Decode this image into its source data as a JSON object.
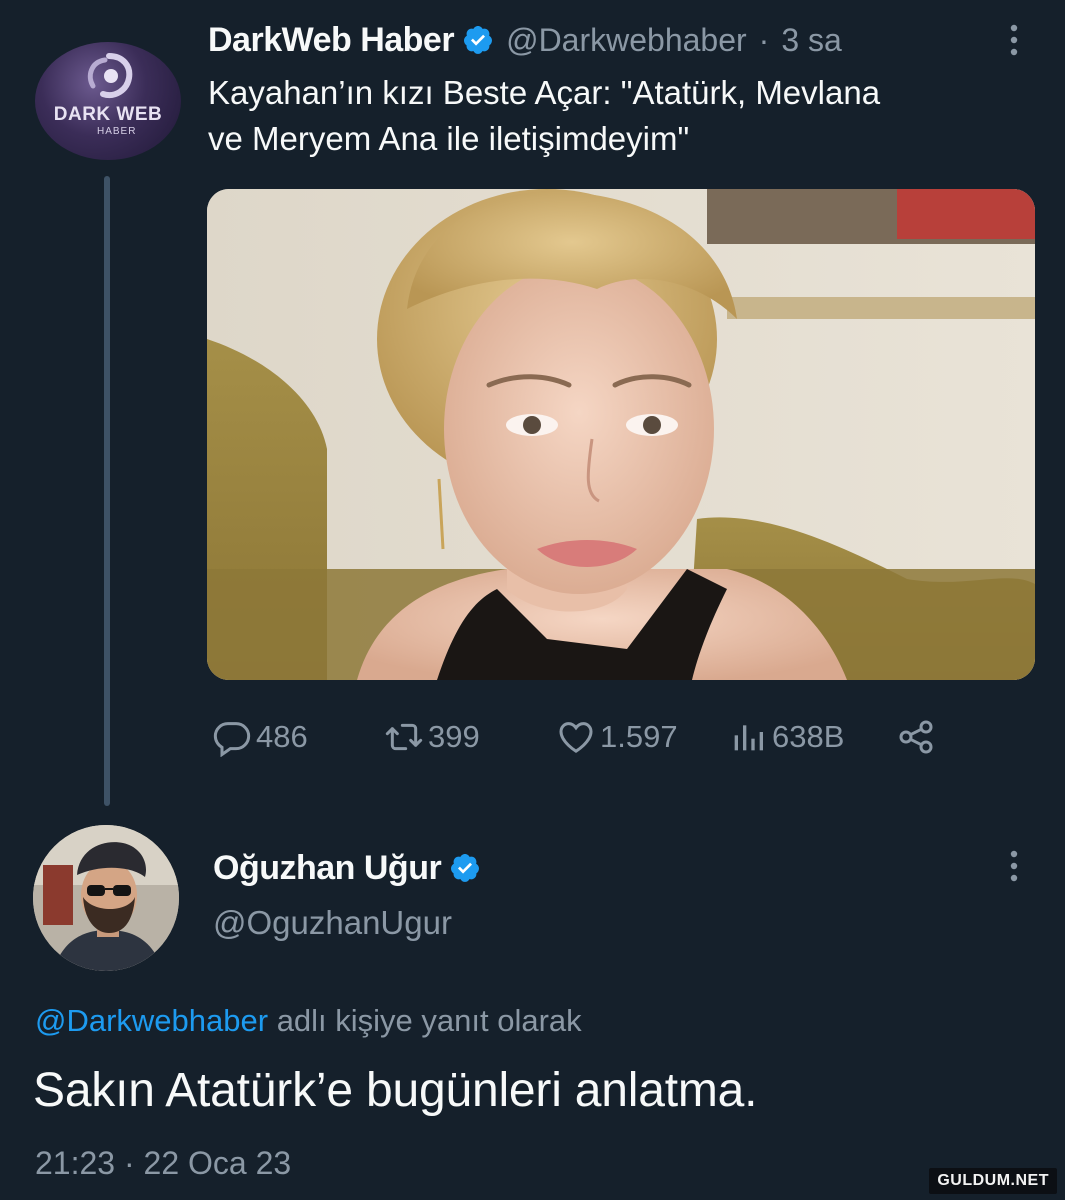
{
  "tweet1": {
    "display_name": "DarkWeb Haber",
    "handle": "@Darkwebhaber",
    "separator": "·",
    "time_ago": "3 sa",
    "avatar_logo_main": "DARK WEB",
    "avatar_logo_sub": "HABER",
    "text_line1": "Kayahan’ın kızı Beste Açar: \"Atatürk, Mevlana",
    "text_line2": "ve Meryem Ana ile iletişimdeyim\"",
    "stats": {
      "replies": "486",
      "retweets": "399",
      "likes": "1.597",
      "views": "638B"
    }
  },
  "tweet2": {
    "display_name": "Oğuzhan Uğur",
    "handle": "@OguzhanUgur",
    "reply_mention": "@Darkwebhaber",
    "reply_suffix": " adlı kişiye yanıt olarak",
    "text": "Sakın Atatürk’e bugünleri anlatma.",
    "timestamp": "21:23 · 22 Oca 23"
  },
  "watermark": "GULDUM.NET",
  "icons": {
    "verified": "verified-badge-icon",
    "more": "more-vertical-icon",
    "reply": "reply-icon",
    "retweet": "retweet-icon",
    "like": "heart-icon",
    "views": "views-chart-icon",
    "share": "share-icon"
  },
  "colors": {
    "background": "#15202b",
    "primary_text": "#f7f9f9",
    "secondary_text": "#8b98a5",
    "link": "#1d9bf0",
    "verified": "#1d9bf0"
  }
}
